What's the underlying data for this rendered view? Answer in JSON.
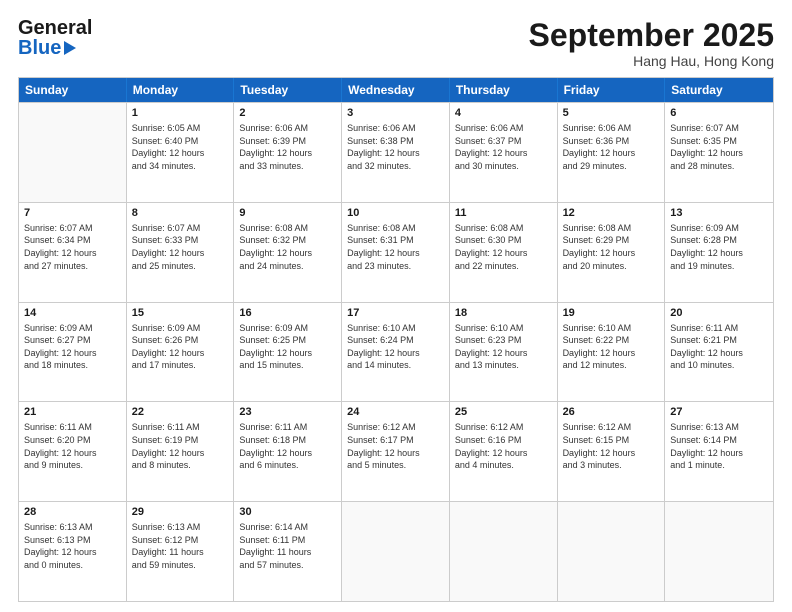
{
  "header": {
    "logo_general": "General",
    "logo_blue": "Blue",
    "month_year": "September 2025",
    "location": "Hang Hau, Hong Kong"
  },
  "days_of_week": [
    "Sunday",
    "Monday",
    "Tuesday",
    "Wednesday",
    "Thursday",
    "Friday",
    "Saturday"
  ],
  "weeks": [
    [
      {
        "day": "",
        "info": ""
      },
      {
        "day": "1",
        "info": "Sunrise: 6:05 AM\nSunset: 6:40 PM\nDaylight: 12 hours\nand 34 minutes."
      },
      {
        "day": "2",
        "info": "Sunrise: 6:06 AM\nSunset: 6:39 PM\nDaylight: 12 hours\nand 33 minutes."
      },
      {
        "day": "3",
        "info": "Sunrise: 6:06 AM\nSunset: 6:38 PM\nDaylight: 12 hours\nand 32 minutes."
      },
      {
        "day": "4",
        "info": "Sunrise: 6:06 AM\nSunset: 6:37 PM\nDaylight: 12 hours\nand 30 minutes."
      },
      {
        "day": "5",
        "info": "Sunrise: 6:06 AM\nSunset: 6:36 PM\nDaylight: 12 hours\nand 29 minutes."
      },
      {
        "day": "6",
        "info": "Sunrise: 6:07 AM\nSunset: 6:35 PM\nDaylight: 12 hours\nand 28 minutes."
      }
    ],
    [
      {
        "day": "7",
        "info": "Sunrise: 6:07 AM\nSunset: 6:34 PM\nDaylight: 12 hours\nand 27 minutes."
      },
      {
        "day": "8",
        "info": "Sunrise: 6:07 AM\nSunset: 6:33 PM\nDaylight: 12 hours\nand 25 minutes."
      },
      {
        "day": "9",
        "info": "Sunrise: 6:08 AM\nSunset: 6:32 PM\nDaylight: 12 hours\nand 24 minutes."
      },
      {
        "day": "10",
        "info": "Sunrise: 6:08 AM\nSunset: 6:31 PM\nDaylight: 12 hours\nand 23 minutes."
      },
      {
        "day": "11",
        "info": "Sunrise: 6:08 AM\nSunset: 6:30 PM\nDaylight: 12 hours\nand 22 minutes."
      },
      {
        "day": "12",
        "info": "Sunrise: 6:08 AM\nSunset: 6:29 PM\nDaylight: 12 hours\nand 20 minutes."
      },
      {
        "day": "13",
        "info": "Sunrise: 6:09 AM\nSunset: 6:28 PM\nDaylight: 12 hours\nand 19 minutes."
      }
    ],
    [
      {
        "day": "14",
        "info": "Sunrise: 6:09 AM\nSunset: 6:27 PM\nDaylight: 12 hours\nand 18 minutes."
      },
      {
        "day": "15",
        "info": "Sunrise: 6:09 AM\nSunset: 6:26 PM\nDaylight: 12 hours\nand 17 minutes."
      },
      {
        "day": "16",
        "info": "Sunrise: 6:09 AM\nSunset: 6:25 PM\nDaylight: 12 hours\nand 15 minutes."
      },
      {
        "day": "17",
        "info": "Sunrise: 6:10 AM\nSunset: 6:24 PM\nDaylight: 12 hours\nand 14 minutes."
      },
      {
        "day": "18",
        "info": "Sunrise: 6:10 AM\nSunset: 6:23 PM\nDaylight: 12 hours\nand 13 minutes."
      },
      {
        "day": "19",
        "info": "Sunrise: 6:10 AM\nSunset: 6:22 PM\nDaylight: 12 hours\nand 12 minutes."
      },
      {
        "day": "20",
        "info": "Sunrise: 6:11 AM\nSunset: 6:21 PM\nDaylight: 12 hours\nand 10 minutes."
      }
    ],
    [
      {
        "day": "21",
        "info": "Sunrise: 6:11 AM\nSunset: 6:20 PM\nDaylight: 12 hours\nand 9 minutes."
      },
      {
        "day": "22",
        "info": "Sunrise: 6:11 AM\nSunset: 6:19 PM\nDaylight: 12 hours\nand 8 minutes."
      },
      {
        "day": "23",
        "info": "Sunrise: 6:11 AM\nSunset: 6:18 PM\nDaylight: 12 hours\nand 6 minutes."
      },
      {
        "day": "24",
        "info": "Sunrise: 6:12 AM\nSunset: 6:17 PM\nDaylight: 12 hours\nand 5 minutes."
      },
      {
        "day": "25",
        "info": "Sunrise: 6:12 AM\nSunset: 6:16 PM\nDaylight: 12 hours\nand 4 minutes."
      },
      {
        "day": "26",
        "info": "Sunrise: 6:12 AM\nSunset: 6:15 PM\nDaylight: 12 hours\nand 3 minutes."
      },
      {
        "day": "27",
        "info": "Sunrise: 6:13 AM\nSunset: 6:14 PM\nDaylight: 12 hours\nand 1 minute."
      }
    ],
    [
      {
        "day": "28",
        "info": "Sunrise: 6:13 AM\nSunset: 6:13 PM\nDaylight: 12 hours\nand 0 minutes."
      },
      {
        "day": "29",
        "info": "Sunrise: 6:13 AM\nSunset: 6:12 PM\nDaylight: 11 hours\nand 59 minutes."
      },
      {
        "day": "30",
        "info": "Sunrise: 6:14 AM\nSunset: 6:11 PM\nDaylight: 11 hours\nand 57 minutes."
      },
      {
        "day": "",
        "info": ""
      },
      {
        "day": "",
        "info": ""
      },
      {
        "day": "",
        "info": ""
      },
      {
        "day": "",
        "info": ""
      }
    ]
  ]
}
